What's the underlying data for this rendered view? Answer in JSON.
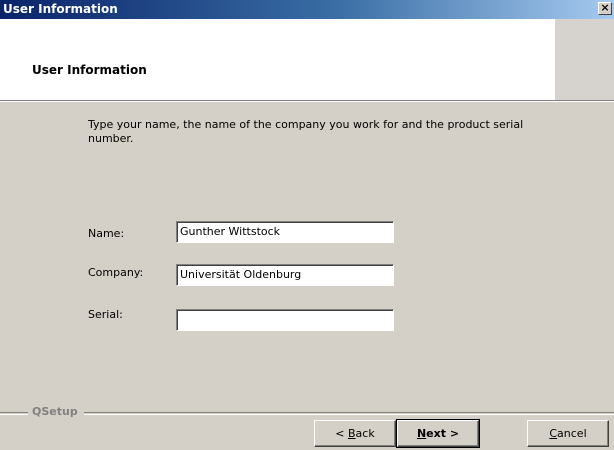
{
  "window": {
    "title": "User Information",
    "close_glyph": "×"
  },
  "header": {
    "title": "User Information"
  },
  "description": "Type your name, the name of the company you work for and the product serial number.",
  "form": {
    "name_label": "Name:",
    "name_value": "Gunther Wittstock",
    "company_label": "Company:",
    "company_value": "Universität Oldenburg",
    "serial_label": "Serial:",
    "serial_value": ""
  },
  "footer": {
    "group_label": "QSetup",
    "back_prefix": "< ",
    "back_mnemonic": "B",
    "back_rest": "ack",
    "next_mnemonic": "N",
    "next_rest": "ext >",
    "cancel_mnemonic": "C",
    "cancel_rest": "ancel"
  }
}
